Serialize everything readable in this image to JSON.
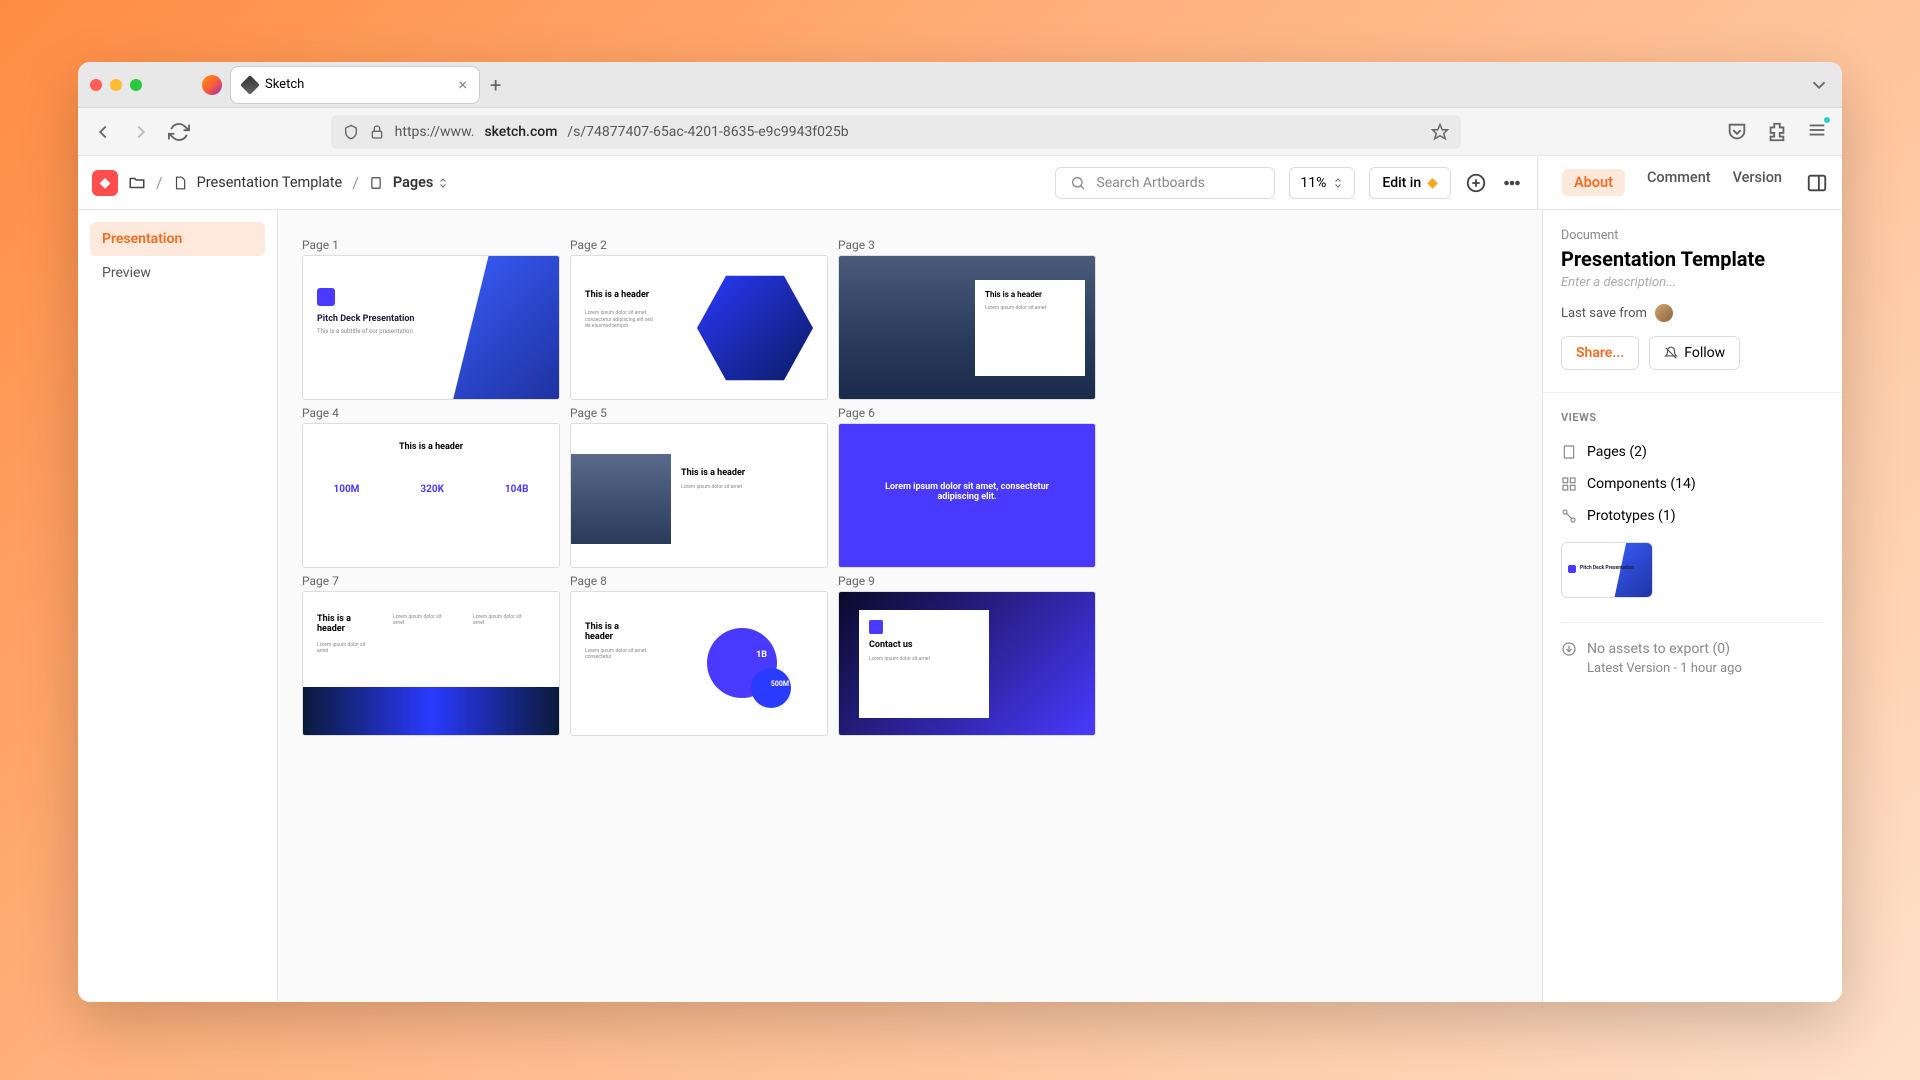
{
  "tab": {
    "title": "Sketch"
  },
  "url": {
    "protocol": "https://www.",
    "domain": "sketch.com",
    "path": "/s/74877407-65ac-4201-8635-e9c9943f025b"
  },
  "breadcrumb": {
    "doc": "Presentation Template",
    "pages": "Pages"
  },
  "toolbar": {
    "search_placeholder": "Search Artboards",
    "zoom": "11%",
    "editin": "Edit in"
  },
  "panel_tabs": {
    "about": "About",
    "comment": "Comment",
    "version": "Version"
  },
  "sidebar": {
    "items": [
      {
        "label": "Presentation"
      },
      {
        "label": "Preview"
      }
    ]
  },
  "artboards": [
    {
      "label": "Page 1",
      "title": "Pitch Deck Presentation",
      "sub": "This is a subtitle of our presentation"
    },
    {
      "label": "Page 2",
      "title": "This is a header",
      "sub": "Lorem ipsum dolor sit amet consectetur adipiscing elit sed do eiusmod tempor"
    },
    {
      "label": "Page 3",
      "title": "This is a header",
      "sub": "Lorem ipsum dolor sit amet"
    },
    {
      "label": "Page 4",
      "title": "This is a header",
      "n1": "100M",
      "n2": "320K",
      "n3": "104B"
    },
    {
      "label": "Page 5",
      "title": "This is a header",
      "sub": "Lorem ipsum dolor sit amet"
    },
    {
      "label": "Page 6",
      "title": "Lorem ipsum dolor sit amet, consectetur adipiscing elit."
    },
    {
      "label": "Page 7",
      "title": "This is a header",
      "sub": "Lorem ipsum dolor sit amet"
    },
    {
      "label": "Page 8",
      "title": "This is a header",
      "n1": "1B",
      "n2": "500M",
      "sub": "Lorem ipsum dolor sit amet consectetur"
    },
    {
      "label": "Page 9",
      "title": "Contact us",
      "sub": "Lorem ipsum dolor sit amet"
    }
  ],
  "inspector": {
    "doc_label": "Document",
    "title": "Presentation Template",
    "desc_placeholder": "Enter a description...",
    "lastsave": "Last save from",
    "share": "Share...",
    "follow": "Follow",
    "views_hdr": "VIEWS",
    "pages": "Pages (2)",
    "components": "Components (14)",
    "prototypes": "Prototypes (1)",
    "export": "No assets to export (0)",
    "version": "Latest Version - 1 hour ago"
  }
}
